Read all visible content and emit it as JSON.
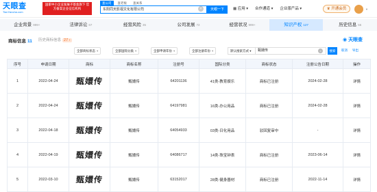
{
  "header": {
    "logo_cn": "天眼查",
    "logo_en": "TianYancha.com",
    "badge_text": "国家中小企业发展子基金旗下 官方备案企业征信机构",
    "search_tabs": [
      "查公司",
      "查老板",
      "查关系"
    ],
    "search_value": "东阳同天影视文化有限公司",
    "search_button": "天眼一下",
    "nav": [
      "应用",
      "合作通道",
      "企业版产品"
    ],
    "vip": "开通会员",
    "accent": "#0084ff"
  },
  "tabs": [
    {
      "label": "企业背景",
      "count": "999+"
    },
    {
      "label": "法律诉讼",
      "count": "67"
    },
    {
      "label": "经营风险",
      "count": "35"
    },
    {
      "label": "公司发展",
      "count": "72"
    },
    {
      "label": "经营状况",
      "count": "999+"
    },
    {
      "label": "知识产权",
      "count": "127"
    },
    {
      "label": "历史信息",
      "count": "66"
    }
  ],
  "section": {
    "title": "商标信息",
    "count": "11",
    "history_label": "历史商标信息",
    "history_count": "27",
    "brand": "天眼查"
  },
  "filters": {
    "items": [
      "全部商标状态",
      "全部国际分类",
      "全部申请年份",
      "全部注册年份"
    ],
    "search_select": "默认搜索方式",
    "search_value": "甄嬛传",
    "search_button": "搜索",
    "cancel": "取消",
    "export": "导出"
  },
  "table": {
    "headers": [
      "序号",
      "申请日期",
      "商标",
      "商标名称",
      "注册号",
      "国际分类",
      "商标状态",
      "注册公告日期",
      "操作"
    ],
    "rows": [
      {
        "idx": "1",
        "date": "2022-04-24",
        "img": "甄嬛传",
        "name": "甄嬛传",
        "reg": "64201136",
        "cls": "41类-教育娱乐",
        "status": "商标已注册",
        "pub": "2024-02-28",
        "op": "详情"
      },
      {
        "idx": "2",
        "date": "2022-04-24",
        "img": "甄嬛传",
        "name": "甄嬛传",
        "reg": "64197981",
        "cls": "16类-办公用品",
        "status": "商标已注册",
        "pub": "2024-02-28",
        "op": "详情"
      },
      {
        "idx": "3",
        "date": "2022-04-18",
        "img": "甄嬛传",
        "name": "甄嬛传",
        "reg": "64054933",
        "cls": "03类-日化用品",
        "status": "驳回复审中",
        "pub": "-",
        "op": "详情"
      },
      {
        "idx": "4",
        "date": "2022-04-19",
        "img": "甄嬛传",
        "name": "甄嬛传",
        "reg": "64086717",
        "cls": "14类-珠宝钟表",
        "status": "商标已注册",
        "pub": "2023-06-14",
        "op": "详情"
      },
      {
        "idx": "5",
        "date": "2022-03-10",
        "img": "甄嬛传",
        "name": "甄嬛传",
        "reg": "63152017",
        "cls": "28类-健身器材",
        "status": "商标已注册",
        "pub": "2022-11-14",
        "op": "详情"
      }
    ]
  }
}
